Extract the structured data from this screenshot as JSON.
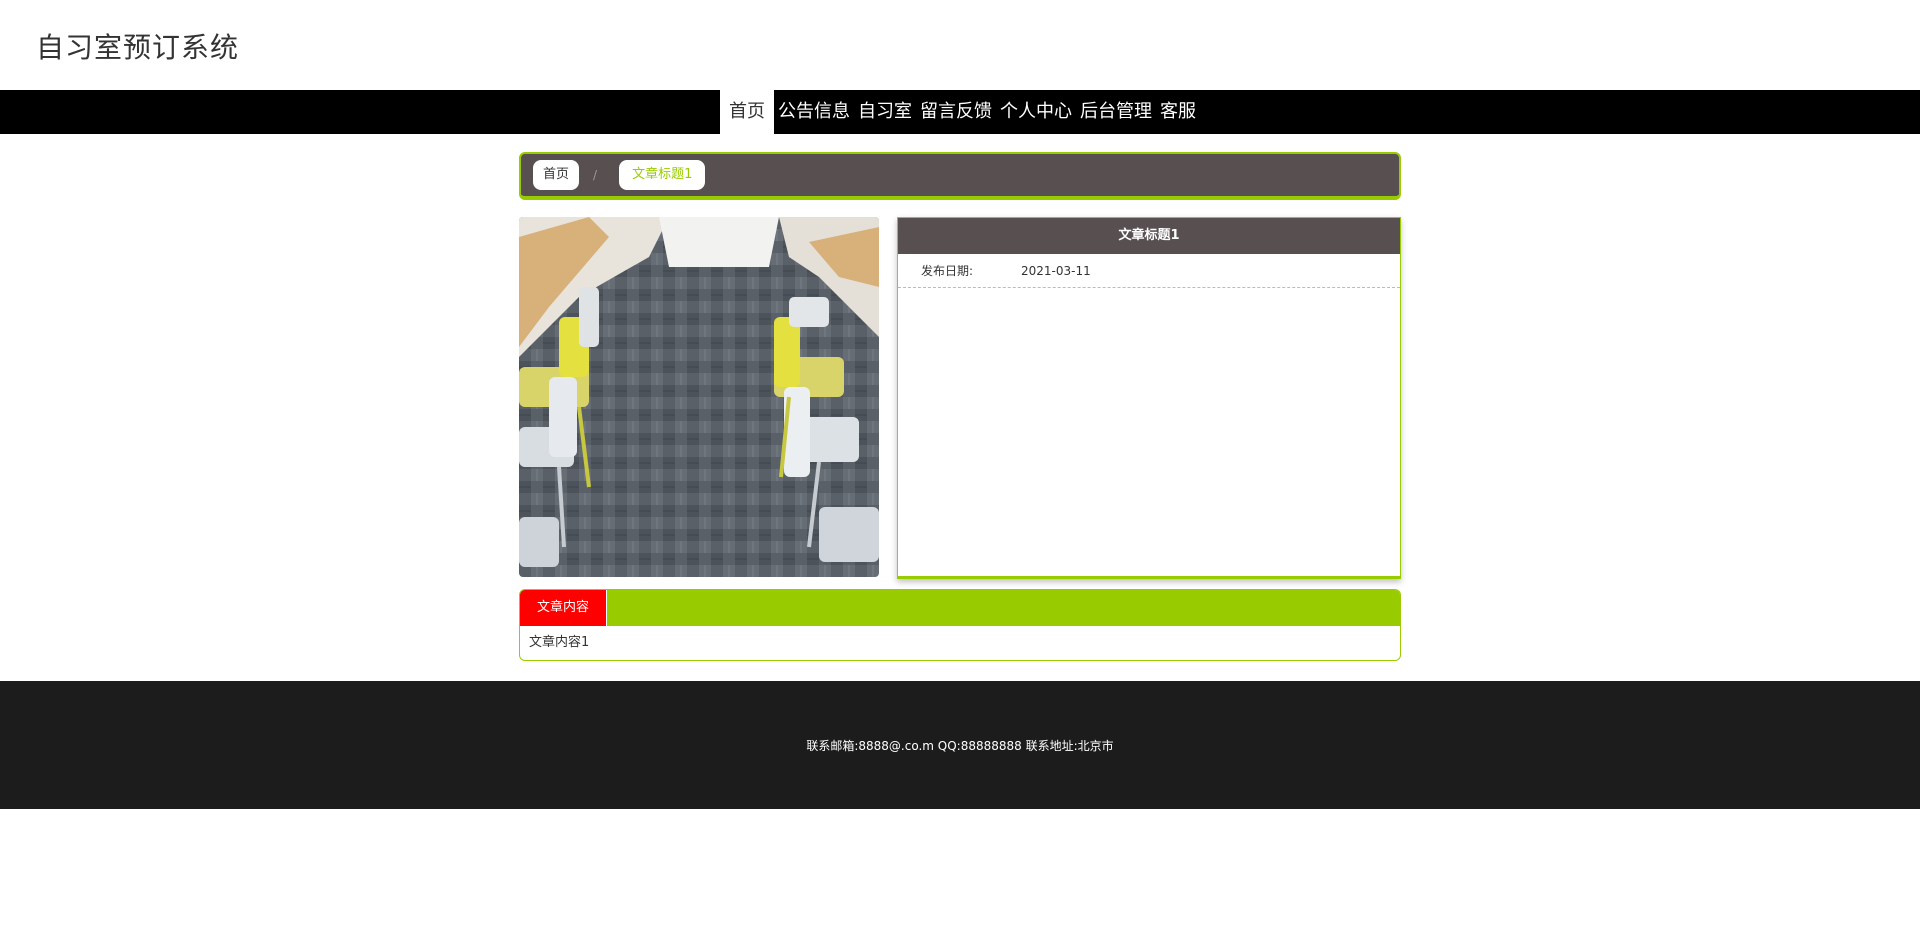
{
  "site": {
    "title": "自习室预订系统"
  },
  "nav": {
    "items": [
      "首页",
      "公告信息",
      "自习室",
      "留言反馈",
      "个人中心",
      "后台管理",
      "客服"
    ],
    "active_index": 0
  },
  "breadcrumb": {
    "home": "首页",
    "separator": "/",
    "current": "文章标题1"
  },
  "article": {
    "title": "文章标题1",
    "date_label": "发布日期:",
    "date_value": "2021-03-11",
    "content_tab": "文章内容",
    "content": "文章内容1"
  },
  "footer": {
    "contact": "联系邮箱:8888@.co.m QQ:88888888 联系地址:北京市"
  },
  "colors": {
    "accent_green": "#99cc00",
    "dark_brown": "#584f50",
    "tab_red": "#ff0000",
    "nav_black": "#000000",
    "footer_dark": "#1c1c1c"
  }
}
